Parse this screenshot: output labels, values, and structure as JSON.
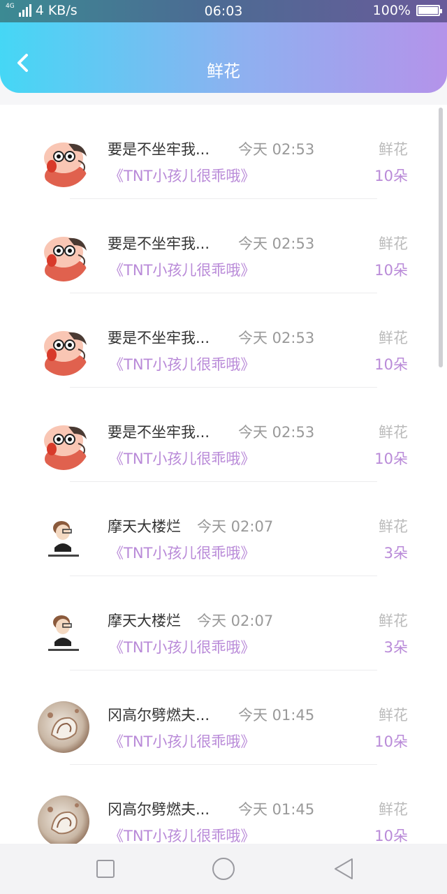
{
  "status_bar": {
    "network": "4G",
    "speed": "4 KB/s",
    "time": "06:03",
    "battery": "100%",
    "battery_level": 1.0
  },
  "header": {
    "title": "鲜花",
    "back_icon": "chevron-left-icon"
  },
  "records": [
    {
      "name": "要是不坐牢我...",
      "time": "今天 02:53",
      "gift": "鲜花",
      "room": "《TNT小孩儿很乖哦》",
      "count": "10朵",
      "avatar": "cartoon-boy"
    },
    {
      "name": "要是不坐牢我...",
      "time": "今天 02:53",
      "gift": "鲜花",
      "room": "《TNT小孩儿很乖哦》",
      "count": "10朵",
      "avatar": "cartoon-boy"
    },
    {
      "name": "要是不坐牢我...",
      "time": "今天 02:53",
      "gift": "鲜花",
      "room": "《TNT小孩儿很乖哦》",
      "count": "10朵",
      "avatar": "cartoon-boy"
    },
    {
      "name": "要是不坐牢我...",
      "time": "今天 02:53",
      "gift": "鲜花",
      "room": "《TNT小孩儿很乖哦》",
      "count": "10朵",
      "avatar": "cartoon-boy"
    },
    {
      "name": "摩天大楼烂",
      "time": "今天 02:07",
      "gift": "鲜花",
      "room": "《TNT小孩儿很乖哦》",
      "count": "3朵",
      "avatar": "sketch-girl"
    },
    {
      "name": "摩天大楼烂",
      "time": "今天 02:07",
      "gift": "鲜花",
      "room": "《TNT小孩儿很乖哦》",
      "count": "3朵",
      "avatar": "sketch-girl"
    },
    {
      "name": "冈高尔劈燃夫...",
      "time": "今天 01:45",
      "gift": "鲜花",
      "room": "《TNT小孩儿很乖哦》",
      "count": "10朵",
      "avatar": "shell-photo"
    },
    {
      "name": "冈高尔劈燃夫...",
      "time": "今天 01:45",
      "gift": "鲜花",
      "room": "《TNT小孩儿很乖哦》",
      "count": "10朵",
      "avatar": "shell-photo"
    }
  ],
  "nav_bar": {
    "recents_icon": "square-icon",
    "home_icon": "circle-icon",
    "back_icon": "triangle-back-icon"
  }
}
